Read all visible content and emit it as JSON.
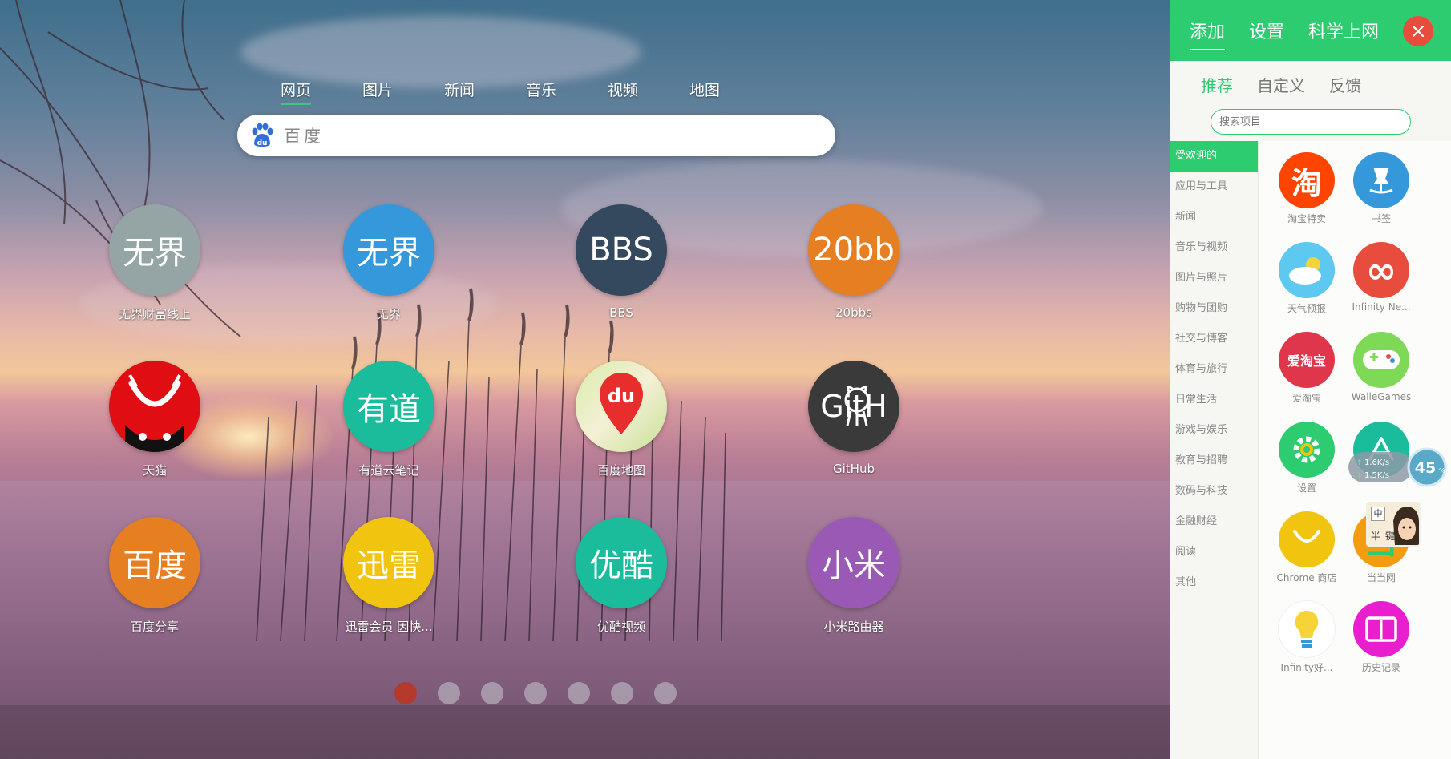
{
  "search": {
    "tabs": [
      "网页",
      "图片",
      "新闻",
      "音乐",
      "视频",
      "地图"
    ],
    "active_tab": 0,
    "placeholder": "百度"
  },
  "tiles": [
    {
      "text": "无界",
      "label": "无界财富线上",
      "color": "#95a5a6"
    },
    {
      "text": "无界",
      "label": "无界",
      "color": "#3498db"
    },
    {
      "text": "BBS",
      "label": "BBS",
      "color": "#34495e"
    },
    {
      "text": "20bb",
      "label": "20bbs",
      "color": "#e67e22"
    },
    {
      "text": "",
      "label": "天猫",
      "color": "#e00d13",
      "icon": "tmall-icon"
    },
    {
      "text": "有道",
      "label": "有道云笔记",
      "color": "#1abc9c"
    },
    {
      "text": "du",
      "label": "百度地图",
      "color": "#ffffff",
      "icon": "baidu-map-icon"
    },
    {
      "text": "GitH",
      "label": "GitHub",
      "color": "#3a3a3a",
      "icon": "github-icon"
    },
    {
      "text": "百度",
      "label": "百度分享",
      "color": "#e67e22"
    },
    {
      "text": "迅雷",
      "label": "迅雷会员 因快...",
      "color": "#f1c40f"
    },
    {
      "text": "优酷",
      "label": "优酷视频",
      "color": "#1abc9c"
    },
    {
      "text": "小米",
      "label": "小米路由器",
      "color": "#9b59b6"
    }
  ],
  "pagination": {
    "count": 7,
    "active": 0
  },
  "panel": {
    "header_tabs": [
      "添加",
      "设置",
      "科学上网"
    ],
    "sub_tabs": [
      "推荐",
      "自定义",
      "反馈"
    ],
    "search_placeholder": "搜索项目",
    "categories": [
      "受欢迎的",
      "应用与工具",
      "新闻",
      "音乐与视频",
      "图片与照片",
      "购物与团购",
      "社交与博客",
      "体育与旅行",
      "日常生活",
      "游戏与娱乐",
      "教育与招聘",
      "数码与科技",
      "金融财经",
      "阅读",
      "其他"
    ],
    "active_category": 0,
    "apps": [
      {
        "label": "淘宝特卖",
        "glyph": "淘",
        "color": "#ff4400",
        "icon": "taobao-icon"
      },
      {
        "label": "书签",
        "glyph": "",
        "color": "#3498db",
        "icon": "bookmark-pin-icon"
      },
      {
        "label": "天气预报",
        "glyph": "",
        "color": "#5dc8f0",
        "icon": "weather-icon"
      },
      {
        "label": "Infinity Ne...",
        "glyph": "∞",
        "color": "#e74c3c",
        "icon": "infinity-icon"
      },
      {
        "label": "爱淘宝",
        "glyph": "爱淘宝",
        "color": "#e0364b",
        "icon": "aitaobao-icon"
      },
      {
        "label": "WalleGames",
        "glyph": "",
        "color": "#7ed957",
        "icon": "gamepad-icon"
      },
      {
        "label": "设置",
        "glyph": "",
        "color": "#2ecc71",
        "icon": "gear-icon"
      },
      {
        "label": "",
        "glyph": "",
        "color": "#1abc9c",
        "icon": "appstore-icon"
      },
      {
        "label": "Chrome 商店",
        "glyph": "",
        "color": "#f1c40f",
        "icon": "chrome-store-icon"
      },
      {
        "label": "当当网",
        "glyph": "当",
        "color": "#f39c12",
        "icon": "dangdang-icon"
      },
      {
        "label": "Infinity好...",
        "glyph": "",
        "color": "#ffffff",
        "icon": "lightbulb-icon"
      },
      {
        "label": "历史记录",
        "glyph": "",
        "color": "#e91ecf",
        "icon": "history-book-icon"
      }
    ]
  },
  "speed_widget": {
    "up": "1.6K/s",
    "down": "1.5K/s",
    "percent": "45",
    "unit": "%"
  },
  "ime_widget": {
    "lang": "中",
    "mode": "半",
    "key": "键"
  }
}
